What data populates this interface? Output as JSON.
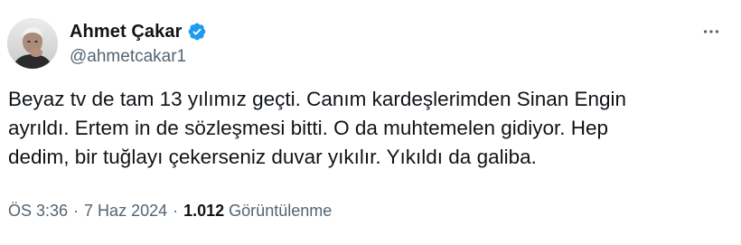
{
  "tweet": {
    "author": {
      "display_name": "Ahmet Çakar",
      "handle": "@ahmetcakar1",
      "verified": true,
      "verified_badge_color": "#1d9bf0",
      "avatar_icon": "avatar-photo"
    },
    "more_icon": "more-horizontal-icon",
    "text": "Beyaz tv de tam 13 yılımız geçti. Canım kardeşlerimden Sinan Engin\nayrıldı. Ertem in de sözleşmesi bitti. O da muhtemelen gidiyor. Hep\ndedim, bir tuğlayı çekerseniz duvar yıkılır. Yıkıldı da galiba.",
    "meta": {
      "time": "ÖS 3:36",
      "separator": "·",
      "date": "7 Haz 2024",
      "views_count": "1.012",
      "views_label": "Görüntülenme"
    }
  },
  "colors": {
    "text_primary": "#0f1419",
    "text_secondary": "#536471",
    "background": "#ffffff"
  }
}
